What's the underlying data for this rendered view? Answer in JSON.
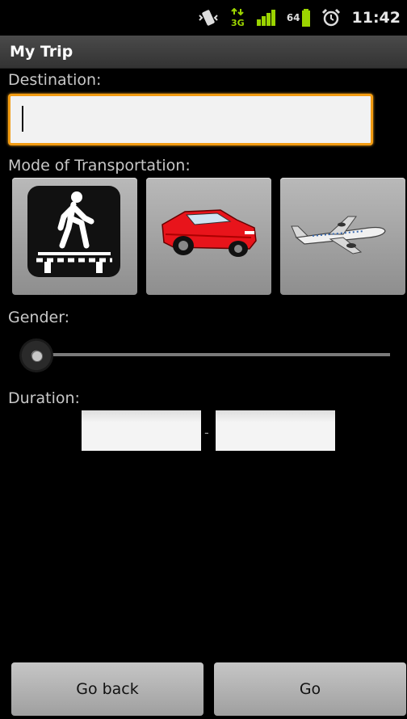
{
  "status": {
    "battery": "64",
    "time": "11:42",
    "network": "3G"
  },
  "app": {
    "title": "My Trip"
  },
  "form": {
    "destination_label": "Destination:",
    "destination_value": "",
    "mode_label": "Mode of Transportation:",
    "modes": [
      "walk",
      "car",
      "plane"
    ],
    "gender_label": "Gender:",
    "gender_value": 0,
    "duration_label": "Duration:",
    "duration_from": "",
    "duration_separator": "-",
    "duration_to": ""
  },
  "buttons": {
    "back": "Go back",
    "go": "Go"
  },
  "colors": {
    "focus": "#f39c12",
    "title_bg": "#3c3c3c",
    "car": "#e8141b"
  }
}
